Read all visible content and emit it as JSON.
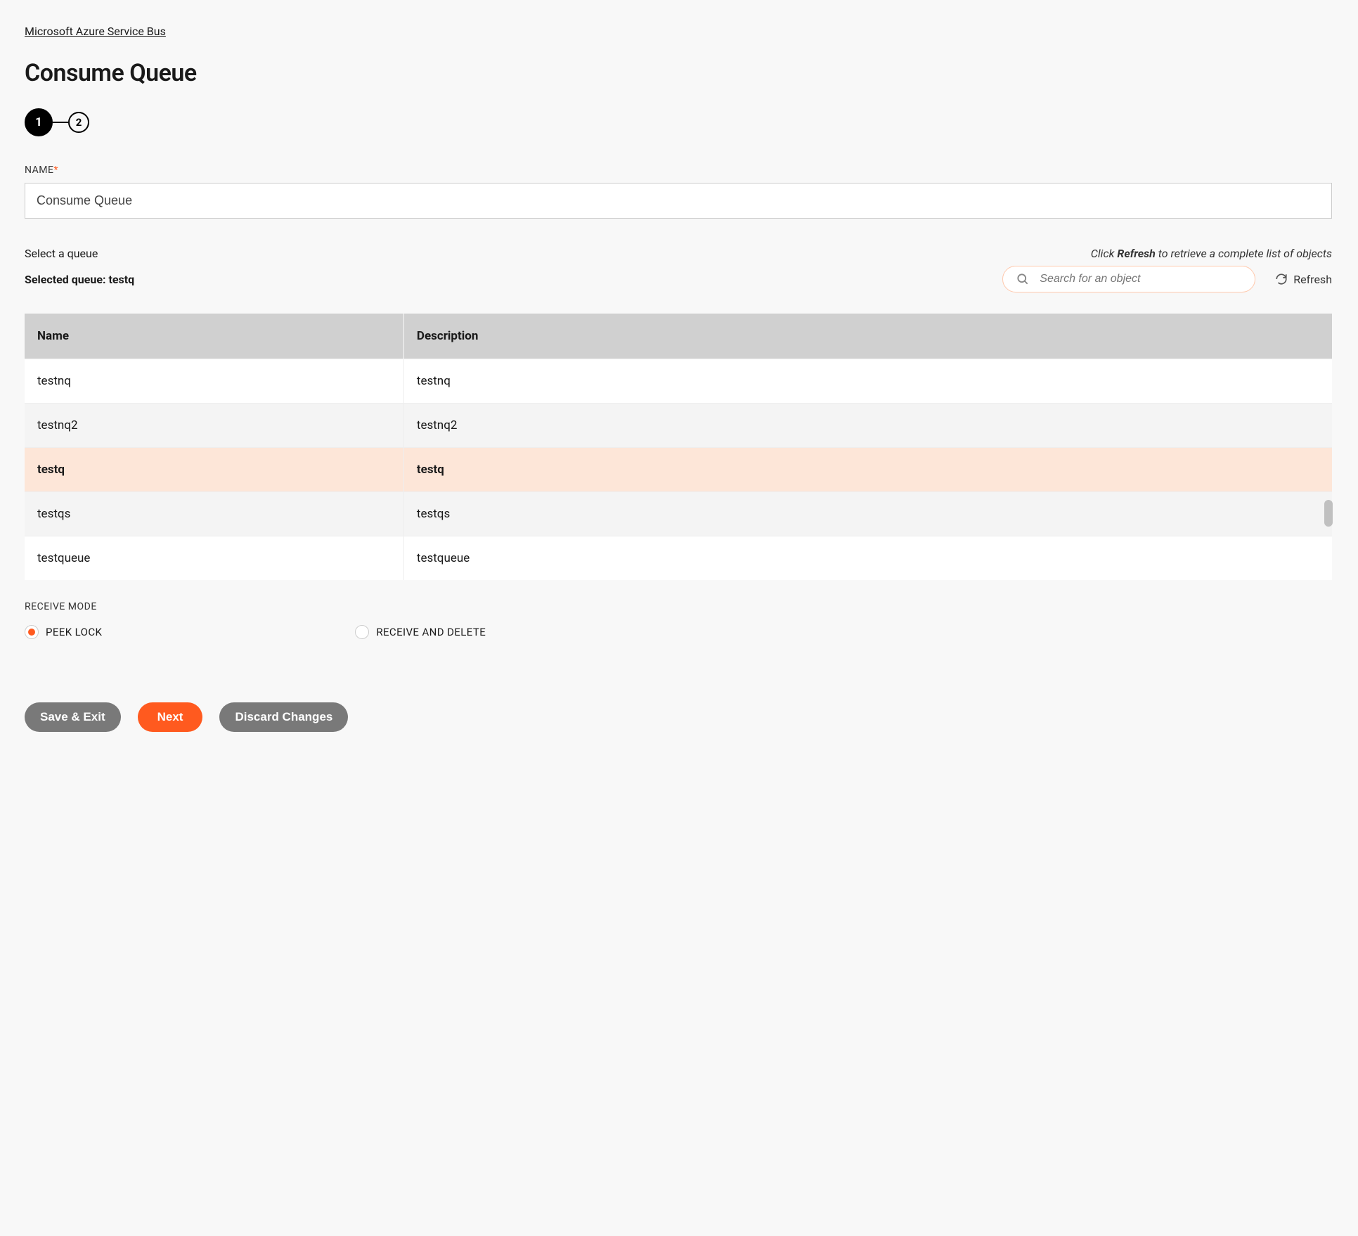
{
  "breadcrumb": {
    "link_text": "Microsoft Azure Service Bus"
  },
  "page_title": "Consume Queue",
  "stepper": {
    "steps": [
      "1",
      "2"
    ],
    "active_index": 0
  },
  "name_field": {
    "label": "NAME",
    "required_marker": "*",
    "value": "Consume Queue"
  },
  "queue_section": {
    "select_label": "Select a queue",
    "helper_prefix": "Click ",
    "helper_bold": "Refresh",
    "helper_suffix": " to retrieve a complete list of objects",
    "selected_prefix": "Selected queue: ",
    "selected_value": "testq",
    "search_placeholder": "Search for an object",
    "refresh_label": "Refresh"
  },
  "table": {
    "columns": [
      "Name",
      "Description"
    ],
    "rows": [
      {
        "name": "testnq",
        "description": "testnq",
        "selected": false
      },
      {
        "name": "testnq2",
        "description": "testnq2",
        "selected": false
      },
      {
        "name": "testq",
        "description": "testq",
        "selected": true
      },
      {
        "name": "testqs",
        "description": "testqs",
        "selected": false
      },
      {
        "name": "testqueue",
        "description": "testqueue",
        "selected": false
      }
    ]
  },
  "receive_mode": {
    "label": "RECEIVE MODE",
    "options": [
      {
        "label": "PEEK LOCK",
        "checked": true
      },
      {
        "label": "RECEIVE AND DELETE",
        "checked": false
      }
    ]
  },
  "footer": {
    "save_exit": "Save & Exit",
    "next": "Next",
    "discard": "Discard Changes"
  }
}
